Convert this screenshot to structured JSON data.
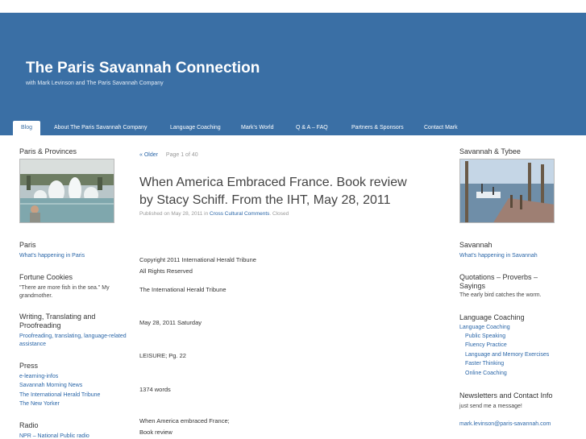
{
  "site": {
    "title": "The Paris Savannah Connection",
    "description": "with Mark Levinson and The Paris Savannah Company"
  },
  "nav": [
    {
      "label": "Blog"
    },
    {
      "label": "About The Paris Savannah Company"
    },
    {
      "label": "Language Coaching"
    },
    {
      "label": "Mark's World"
    },
    {
      "label": "Q & A – FAQ"
    },
    {
      "label": "Partners & Sponsors"
    },
    {
      "label": "Contact Mark"
    }
  ],
  "left_sidebar": {
    "paris_provinces": {
      "title": "Paris & Provinces"
    },
    "paris": {
      "title": "Paris",
      "link": "What's happening in Paris"
    },
    "fortune": {
      "title": "Fortune Cookies",
      "text": "\"There are more fish in the sea.\" My grandmother."
    },
    "writing": {
      "title": "Writing, Translating and Proofreading",
      "link": "Proofreading, translating, language-related assistance"
    },
    "press": {
      "title": "Press",
      "links": [
        "e-learning-infos",
        "Savannah Morning News",
        "The International Herald Tribune",
        "The New Yorker"
      ]
    },
    "radio": {
      "title": "Radio",
      "link": "NPR – National Public radio"
    }
  },
  "main": {
    "pager": {
      "older": "« Older",
      "count": "Page 1 of 40"
    },
    "post": {
      "title": "When America Embraced France. Book review by Stacy Schiff. From the IHT, May 28, 2011",
      "published_prefix": "Published on",
      "date": "May 28, 2011",
      "in": "in",
      "category": "Cross Cultural Comments",
      "status": ". Closed",
      "lines": [
        "Copyright 2011 International Herald Tribune",
        "All Rights Reserved",
        "The International Herald Tribune",
        "May 28, 2011 Saturday",
        "LEISURE; Pg. 22",
        "1374 words",
        "When America embraced France;",
        "Book review"
      ]
    }
  },
  "right_sidebar": {
    "savannah_tybee": {
      "title": "Savannah & Tybee"
    },
    "savannah": {
      "title": "Savannah",
      "link": "What's happening in Savannah"
    },
    "quotations": {
      "title": "Quotations – Proverbs – Sayings",
      "text": "The early bird catches the worm."
    },
    "language": {
      "title": "Language Coaching",
      "link": "Language Coaching",
      "sublinks": [
        "Public Speaking",
        "Fluency Practice",
        "Language and Memory Exercises",
        "Faster Thinking",
        "Online Coaching"
      ]
    },
    "newsletters": {
      "title": "Newsletters and Contact Info",
      "text": "just send me a message!",
      "email": "mark.levinson@paris-savannah.com"
    }
  },
  "colors": {
    "header": "#3a6fa5",
    "link": "#2a66a8"
  }
}
